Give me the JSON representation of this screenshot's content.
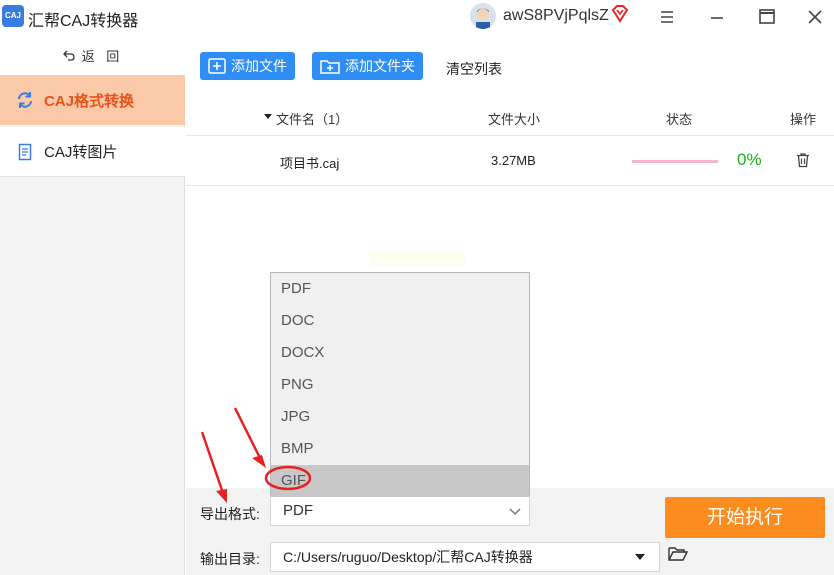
{
  "app": {
    "title": "汇帮CAJ转换器",
    "logo_text": "CAJ",
    "user_name": "awS8PVjPqlsZ"
  },
  "sidebar": {
    "back_label": "返 回",
    "items": [
      {
        "label": "CAJ格式转换",
        "icon": "refresh-icon",
        "active": true
      },
      {
        "label": "CAJ转图片",
        "icon": "document-icon",
        "active": false
      }
    ]
  },
  "toolbar": {
    "add_file_label": "添加文件",
    "add_folder_label": "添加文件夹",
    "clear_label": "清空列表"
  },
  "table": {
    "columns": {
      "filename": "文件名（1）",
      "size": "文件大小",
      "status": "状态",
      "action": "操作"
    },
    "rows": [
      {
        "name": "项目书.caj",
        "size": "3.27MB",
        "progress": "0%"
      }
    ]
  },
  "dropdown": {
    "options": [
      "PDF",
      "DOC",
      "DOCX",
      "PNG",
      "JPG",
      "BMP",
      "GIF"
    ],
    "highlighted": "GIF"
  },
  "bottom": {
    "format_label": "导出格式:",
    "format_value": "PDF",
    "output_label": "输出目录:",
    "output_path": "C:/Users/ruguo/Desktop/汇帮CAJ转换器",
    "start_label": "开始执行"
  },
  "colors": {
    "accent_blue": "#2f8ef5",
    "active_tab_bg": "#f9c9a8",
    "active_tab_text": "#e8531c",
    "start_button": "#fb8c1d",
    "progress_text": "#1db31d",
    "annotation_red": "#e82020"
  }
}
